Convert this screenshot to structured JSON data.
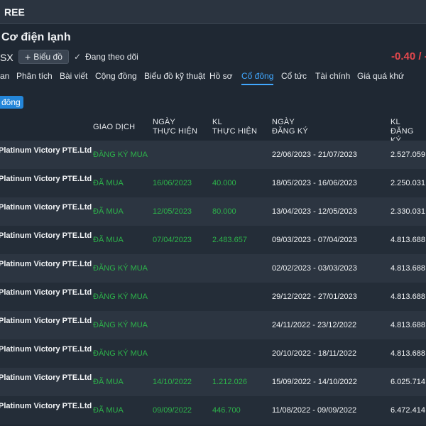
{
  "header": {
    "ticker": "REE"
  },
  "company": {
    "name": "Cơ điện lạnh"
  },
  "toolbar": {
    "exchange": "SX",
    "chart_label": "Biểu đồ",
    "follow_label": "Đang theo dõi",
    "price_change": "-0.40 / -"
  },
  "tabs": [
    {
      "label": "an"
    },
    {
      "label": "Phân tích"
    },
    {
      "label": "Bài viết"
    },
    {
      "label": "Cộng đồng"
    },
    {
      "label": "Biểu đồ kỹ thuật"
    },
    {
      "label": "Hồ sơ"
    },
    {
      "label": "Cổ đông"
    },
    {
      "label": "Cổ tức"
    },
    {
      "label": "Tài chính"
    },
    {
      "label": "Giá quá khứ"
    }
  ],
  "subtab": {
    "label": "đông"
  },
  "table": {
    "headers": {
      "type": "GIAO DỊCH",
      "exec_date_1": "NGÀY",
      "exec_date_2": "THỰC HIỆN",
      "exec_vol_1": "KL",
      "exec_vol_2": "THỰC HIỆN",
      "reg_date_1": "NGÀY",
      "reg_date_2": "ĐĂNG KÝ",
      "reg_vol_1": "KL",
      "reg_vol_2": "ĐĂNG KÝ"
    },
    "rows": [
      {
        "name": "Platinum Victory PTE.Ltd",
        "type": "ĐĂNG KÝ MUA",
        "exec_date": "",
        "exec_vol": "",
        "reg_date": "22/06/2023 - 21/07/2023",
        "reg_vol": "2.527.059"
      },
      {
        "name": "Platinum Victory PTE.Ltd",
        "type": "ĐÃ MUA",
        "exec_date": "16/06/2023",
        "exec_vol": "40.000",
        "reg_date": "18/05/2023 - 16/06/2023",
        "reg_vol": "2.250.031"
      },
      {
        "name": "Platinum Victory PTE.Ltd",
        "type": "ĐÃ MUA",
        "exec_date": "12/05/2023",
        "exec_vol": "80.000",
        "reg_date": "13/04/2023 - 12/05/2023",
        "reg_vol": "2.330.031"
      },
      {
        "name": "Platinum Victory PTE.Ltd",
        "type": "ĐÃ MUA",
        "exec_date": "07/04/2023",
        "exec_vol": "2.483.657",
        "reg_date": "09/03/2023 - 07/04/2023",
        "reg_vol": "4.813.688"
      },
      {
        "name": "Platinum Victory PTE.Ltd",
        "type": "ĐĂNG KÝ MUA",
        "exec_date": "",
        "exec_vol": "",
        "reg_date": "02/02/2023 - 03/03/2023",
        "reg_vol": "4.813.688"
      },
      {
        "name": "Platinum Victory PTE.Ltd",
        "type": "ĐĂNG KÝ MUA",
        "exec_date": "",
        "exec_vol": "",
        "reg_date": "29/12/2022 - 27/01/2023",
        "reg_vol": "4.813.688"
      },
      {
        "name": "Platinum Victory PTE.Ltd",
        "type": "ĐĂNG KÝ MUA",
        "exec_date": "",
        "exec_vol": "",
        "reg_date": "24/11/2022 - 23/12/2022",
        "reg_vol": "4.813.688"
      },
      {
        "name": "Platinum Victory PTE.Ltd",
        "type": "ĐĂNG KÝ MUA",
        "exec_date": "",
        "exec_vol": "",
        "reg_date": "20/10/2022 - 18/11/2022",
        "reg_vol": "4.813.688"
      },
      {
        "name": "Platinum Victory PTE.Ltd",
        "type": "ĐÃ MUA",
        "exec_date": "14/10/2022",
        "exec_vol": "1.212.026",
        "reg_date": "15/09/2022 - 14/10/2022",
        "reg_vol": "6.025.714"
      },
      {
        "name": "Platinum Victory PTE.Ltd",
        "type": "ĐÃ MUA",
        "exec_date": "09/09/2022",
        "exec_vol": "446.700",
        "reg_date": "11/08/2022 - 09/09/2022",
        "reg_vol": "6.472.414"
      }
    ]
  }
}
